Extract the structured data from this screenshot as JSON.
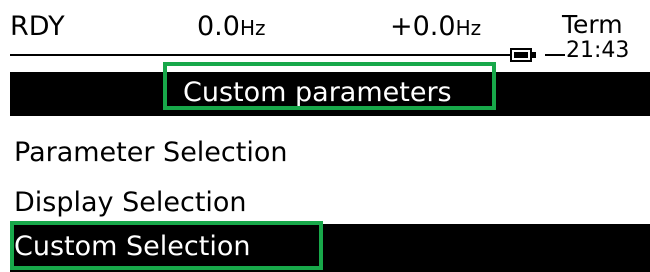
{
  "status": {
    "state": "RDY",
    "frequency_ref": "0.0",
    "frequency_ref_unit": "Hz",
    "frequency_out": "+0.0",
    "frequency_out_unit": "Hz",
    "channel": "Term",
    "time": "21:43",
    "battery_icon": "battery-icon"
  },
  "title": "Custom parameters",
  "menu": {
    "items": [
      {
        "label": "Parameter Selection"
      },
      {
        "label": "Display Selection"
      },
      {
        "label": "Custom Selection",
        "selected": true
      }
    ]
  },
  "colors": {
    "highlight": "#18a84a",
    "background": "#ffffff",
    "foreground": "#000000"
  }
}
